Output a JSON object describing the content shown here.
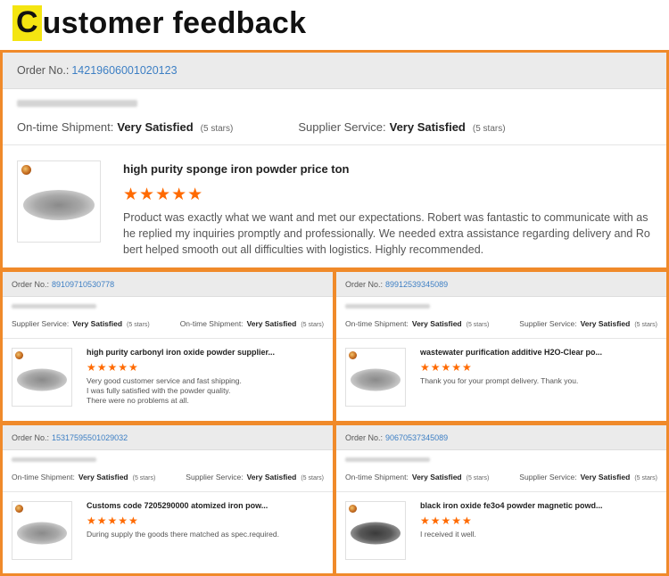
{
  "header": {
    "title_highlight": "C",
    "title_rest": "ustomer feedback"
  },
  "labels": {
    "order_label": "Order No.:",
    "on_time_label": "On-time Shipment:",
    "supplier_label": "Supplier Service:",
    "very_satisfied": "Very Satisfied",
    "five_stars": "(5 stars)",
    "star_rating": "★★★★★"
  },
  "colors": {
    "accent_border": "#f08a2a",
    "star": "#ff6a00",
    "order_link": "#3d7fc4",
    "title_highlight": "#f4e511"
  },
  "feedback": [
    {
      "order_no": "14219606001020123",
      "rating_out_of_5": 5,
      "product_title": "high purity sponge iron powder price ton",
      "review": "Product was exactly what we want and met our expectations. Robert was fantastic to communicate with as he replied my inquiries promptly and professionally. We needed extra assistance regarding delivery and Robert helped smooth out all difficulties with logistics. Highly recommended."
    },
    {
      "order_no": "89109710530778",
      "rating_out_of_5": 5,
      "product_title": "high purity carbonyl iron oxide powder supplier...",
      "review_lines": [
        "Very good customer service and fast shipping.",
        "I was fully satisfied with the powder quality.",
        "There were no problems at all."
      ]
    },
    {
      "order_no": "89912539345089",
      "rating_out_of_5": 5,
      "product_title": "wastewater purification additive H2O-Clear po...",
      "review_lines": [
        "Thank you for your prompt delivery. Thank you."
      ]
    },
    {
      "order_no": "15317595501029032",
      "rating_out_of_5": 5,
      "product_title": "Customs code 7205290000 atomized iron pow...",
      "review_lines": [
        "During supply the goods there matched as spec.required."
      ]
    },
    {
      "order_no": "90670537345089",
      "rating_out_of_5": 5,
      "product_title": "black iron oxide fe3o4 powder magnetic powd...",
      "review_lines": [
        "I received it well."
      ]
    }
  ]
}
